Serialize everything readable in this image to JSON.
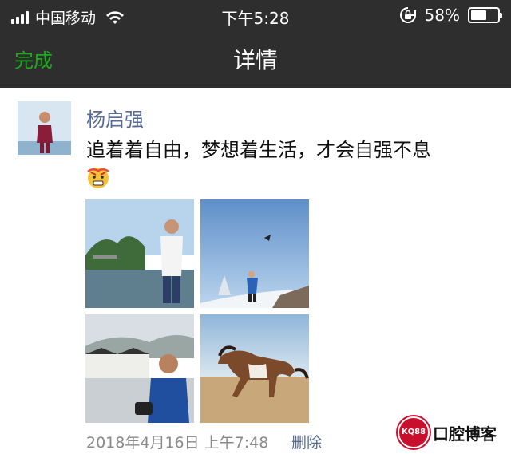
{
  "status_bar": {
    "carrier": "中国移动",
    "time": "下午5:28",
    "battery_percent": "58%",
    "battery_level": 0.58,
    "icons": [
      "signal-icon",
      "wifi-icon",
      "rotation-lock-icon",
      "battery-icon"
    ]
  },
  "nav": {
    "done_label": "完成",
    "title": "详情"
  },
  "post": {
    "author": "杨启强",
    "text": "追着着自由，梦想着生活，才会自强不息",
    "emoji": "grimace-emoji",
    "photos": [
      "lake-portrait",
      "snow-kite-flyer",
      "village-portrait",
      "running-horse"
    ],
    "timestamp": "2018年4月16日 上午7:48",
    "delete_label": "删除"
  },
  "watermark": {
    "badge": "KQ88",
    "text": "口腔博客"
  },
  "colors": {
    "nav_bg": "#2e2e2e",
    "accent_green": "#1aad19",
    "link_blue": "#576b95",
    "meta_gray": "#8a8a8a"
  }
}
